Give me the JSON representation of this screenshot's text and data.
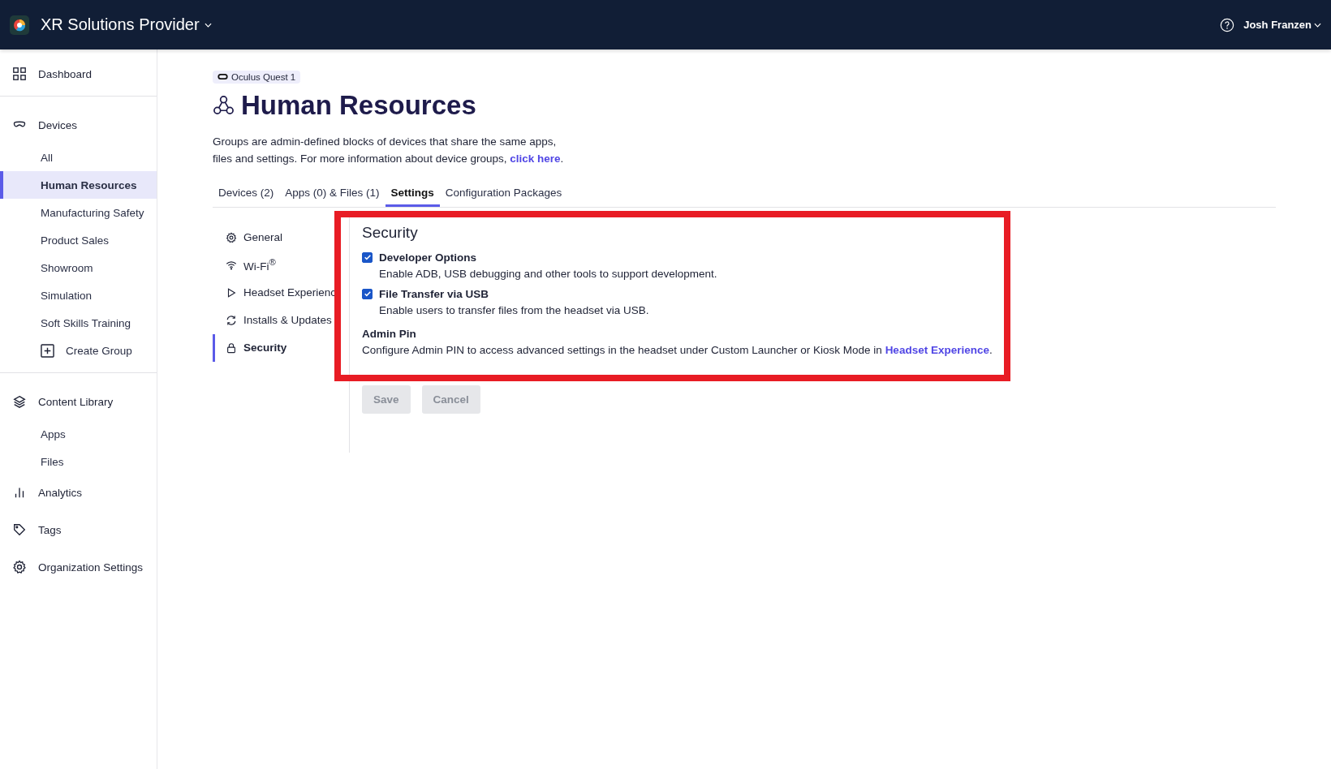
{
  "header": {
    "org_name": "XR Solutions Provider",
    "user_name": "Josh Franzen"
  },
  "sidebar": {
    "sections": [
      {
        "label": "Dashboard",
        "selected": false
      },
      {
        "label": "Devices",
        "selected": false,
        "children": [
          {
            "label": "All",
            "kind": "link",
            "selected": false
          },
          {
            "label": "Human Resources",
            "kind": "link",
            "selected": true
          },
          {
            "label": "Manufacturing Safety",
            "kind": "link",
            "selected": false
          },
          {
            "label": "Product Sales",
            "kind": "link",
            "selected": false
          },
          {
            "label": "Showroom",
            "kind": "link",
            "selected": false
          },
          {
            "label": "Simulation",
            "kind": "link",
            "selected": false
          },
          {
            "label": "Soft Skills Training",
            "kind": "link",
            "selected": false
          },
          {
            "label": "Create Group",
            "kind": "create",
            "selected": false
          }
        ]
      },
      {
        "label": "Content Library",
        "selected": false,
        "children": [
          {
            "label": "Apps",
            "kind": "link",
            "selected": false
          },
          {
            "label": "Files",
            "kind": "link",
            "selected": false
          }
        ]
      },
      {
        "label": "Analytics",
        "selected": false
      },
      {
        "label": "Tags",
        "selected": false
      },
      {
        "label": "Organization Settings",
        "selected": false
      }
    ]
  },
  "page": {
    "device_badge": "Oculus Quest 1",
    "title": "Human Resources",
    "description": "Groups are admin-defined blocks of devices that share the same apps, files and settings. For more information about device groups,",
    "description_link": "click here",
    "description_end": ".",
    "tabs": [
      {
        "label": "Devices (2)",
        "selected": false
      },
      {
        "label": "Apps (0) & Files (1)",
        "selected": false
      },
      {
        "label": "Settings",
        "selected": true
      },
      {
        "label": "Configuration Packages",
        "selected": false
      }
    ],
    "settings_nav": [
      {
        "label": "General",
        "selected": false
      },
      {
        "label": "Wi-Fi$^{®}$",
        "selected": false
      },
      {
        "label": "Headset Experienc",
        "selected": false
      },
      {
        "label": "Installs & Updates",
        "selected": false
      },
      {
        "label": "Security",
        "selected": true
      }
    ],
    "section_title": "Security",
    "options": [
      {
        "label": "Developer Options",
        "description": "Enable ADB, USB debugging and other tools to support development.",
        "checked": true
      },
      {
        "label": "File Transfer via USB",
        "description": "Enable users to transfer files from the headset via USB.",
        "checked": true
      }
    ],
    "admin_pin": {
      "label": "Admin Pin",
      "description": "Configure Admin PIN to access advanced settings in the headset under Custom Launcher or Kiosk Mode in",
      "link": "Headset Experience",
      "end": "."
    },
    "buttons": [
      {
        "label": "Save",
        "disabled": true
      },
      {
        "label": "Cancel",
        "disabled": true
      }
    ]
  }
}
